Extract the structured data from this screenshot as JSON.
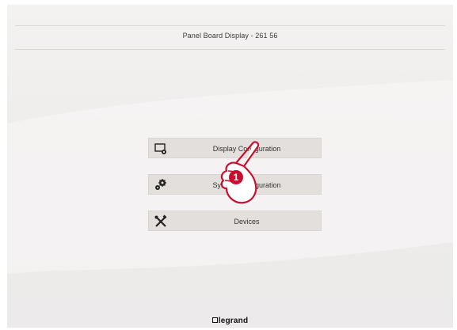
{
  "header": {
    "title": "Panel Board Display - 261 56"
  },
  "menu": [
    {
      "label": "Display Configuration",
      "icon": "display-settings-icon"
    },
    {
      "label": "System Configuration",
      "icon": "gears-icon"
    },
    {
      "label": "Devices",
      "icon": "tools-icon"
    }
  ],
  "callout": {
    "number": "1",
    "icon": "pointing-hand-icon"
  },
  "footer": {
    "brand": "legrand"
  },
  "colors": {
    "accent": "#c8102e",
    "button_bg": "#e2dfdd",
    "background": "#efedec"
  }
}
